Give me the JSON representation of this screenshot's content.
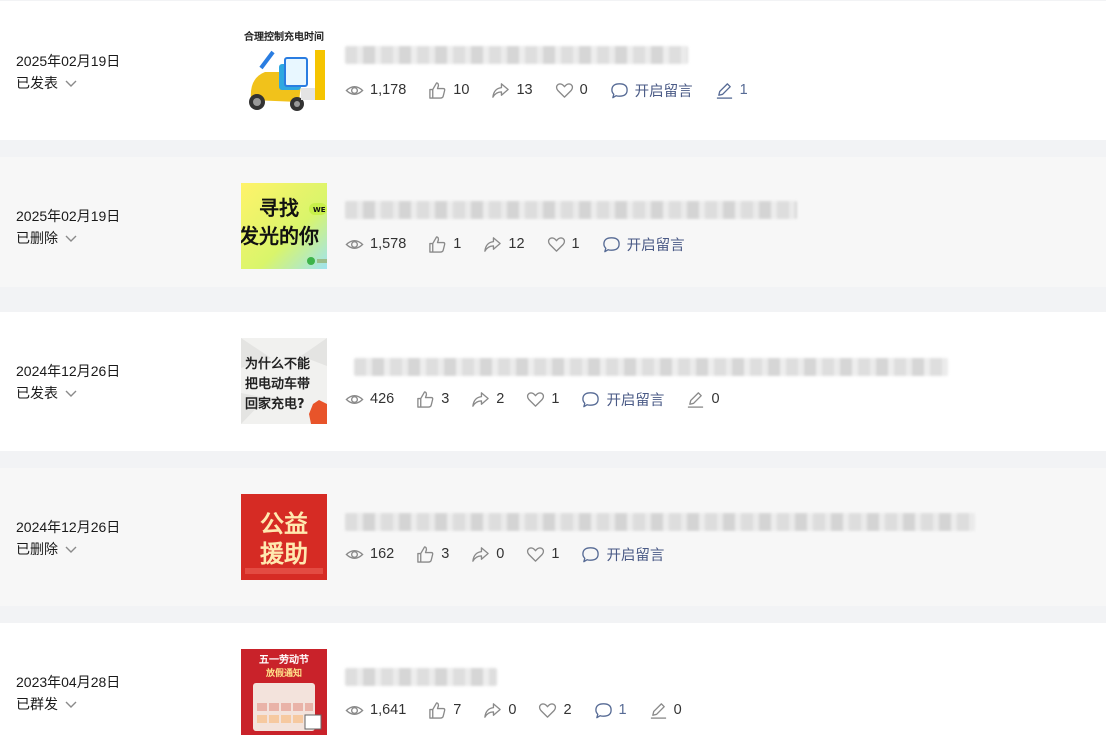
{
  "articles": [
    {
      "date": "2025年02月19日",
      "status": "已发表",
      "thumb_text": "合理控制充电时间",
      "views": "1,178",
      "likes": "10",
      "shares": "13",
      "favorites": "0",
      "comment_label": "开启留言",
      "edits": "1"
    },
    {
      "date": "2025年02月19日",
      "status": "已删除",
      "thumb_text_1": "寻找",
      "thumb_text_2": "发光的你",
      "thumb_badge": "WE",
      "views": "1,578",
      "likes": "1",
      "shares": "12",
      "favorites": "1",
      "comment_label": "开启留言"
    },
    {
      "date": "2024年12月26日",
      "status": "已发表",
      "thumb_text_1": "为什么不能",
      "thumb_text_2": "把电动车带",
      "thumb_text_3": "回家充电?",
      "views": "426",
      "likes": "3",
      "shares": "2",
      "favorites": "1",
      "comment_label": "开启留言",
      "edits": "0"
    },
    {
      "date": "2024年12月26日",
      "status": "已删除",
      "thumb_text_1": "公益",
      "thumb_text_2": "援助",
      "views": "162",
      "likes": "3",
      "shares": "0",
      "favorites": "1",
      "comment_label": "开启留言"
    },
    {
      "date": "2023年04月28日",
      "status": "已群发",
      "thumb_text_1": "五一劳动节",
      "thumb_text_2": "放假通知",
      "views": "1,641",
      "likes": "7",
      "shares": "0",
      "favorites": "2",
      "comments": "1",
      "edits": "0"
    }
  ],
  "colors": {
    "page_bg": "#f2f3f5",
    "card_bg": "#ffffff",
    "card_bg_deleted": "#f7f7f7",
    "link_blue": "#576b95",
    "icon_gray": "#8a8a8a"
  }
}
